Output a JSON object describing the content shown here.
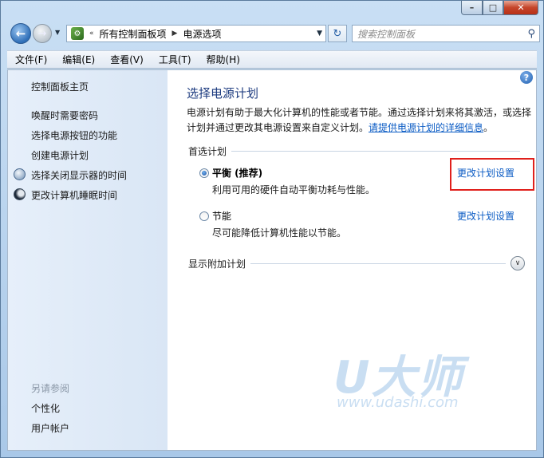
{
  "window": {
    "caption": {
      "minimize": "–",
      "maximize": "□",
      "close": "✕"
    }
  },
  "address_bar": {
    "chevrons": "«",
    "crumbs": [
      "所有控制面板项",
      "电源选项"
    ],
    "separator": "▶",
    "search_placeholder": "搜索控制面板"
  },
  "menu": [
    "文件(F)",
    "编辑(E)",
    "查看(V)",
    "工具(T)",
    "帮助(H)"
  ],
  "sidebar": {
    "home": "控制面板主页",
    "links": [
      "唤醒时需要密码",
      "选择电源按钮的功能",
      "创建电源计划",
      "选择关闭显示器的时间",
      "更改计算机睡眠时间"
    ],
    "see_also_title": "另请参阅",
    "see_also": [
      "个性化",
      "用户帐户"
    ]
  },
  "main": {
    "title": "选择电源计划",
    "desc_line": "电源计划有助于最大化计算机的性能或者节能。通过选择计划来将其激活，或选择计划并通过更改其电源设置来自定义计划。",
    "desc_link": "请提供电源计划的详细信息",
    "desc_end": "。",
    "preferred_title": "首选计划",
    "plans": [
      {
        "name": "平衡 (推荐)",
        "desc": "利用可用的硬件自动平衡功耗与性能。",
        "link": "更改计划设置",
        "selected": true
      },
      {
        "name": "节能",
        "desc": "尽可能降低计算机性能以节能。",
        "link": "更改计划设置",
        "selected": false
      }
    ],
    "extra_title": "显示附加计划"
  },
  "watermark": {
    "logo": "U大师",
    "url": "www.udashi.com"
  },
  "colors": {
    "highlight": "#e0201c",
    "link": "#0a5bc4",
    "title": "#1e3c80"
  }
}
